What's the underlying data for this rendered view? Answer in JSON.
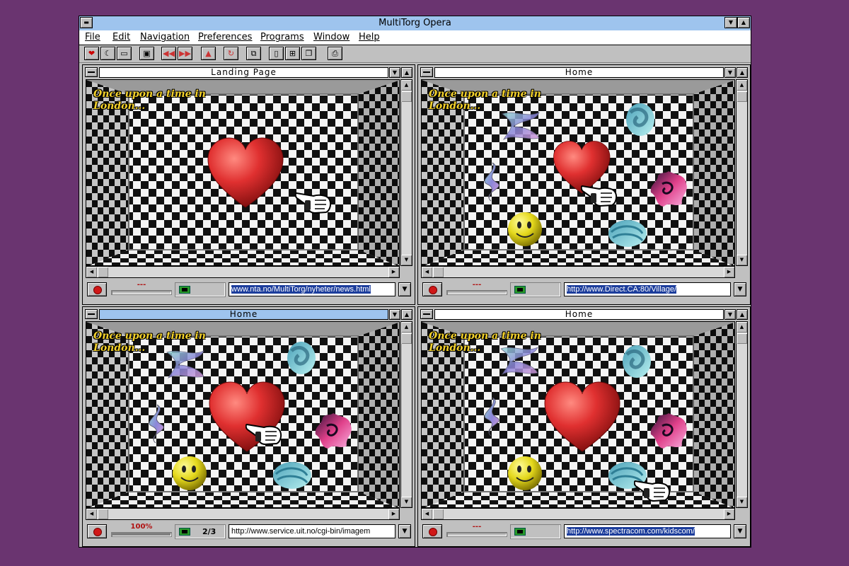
{
  "app": {
    "title": "MultiTorg Opera"
  },
  "menu": [
    "File",
    "Edit",
    "Navigation",
    "Preferences",
    "Programs",
    "Window",
    "Help"
  ],
  "toolbar_icons": [
    "opera-logo-icon",
    "back-moon-icon",
    "open-folder-icon",
    "save-icon",
    "previous-icon",
    "next-icon",
    "home-icon",
    "reload-icon",
    "copy-icon",
    "new-page-icon",
    "tile-icon",
    "cascade-icon",
    "print-icon"
  ],
  "panes": [
    {
      "title": "Landing Page",
      "story": "Once upon a time in London...",
      "progress_label": "---",
      "progress": 0,
      "counter": "",
      "url": "www.nta.no/MultiTorg/nyheter/news.html",
      "url_selected": true
    },
    {
      "title": "Home",
      "story": "Once upon a time in London...",
      "progress_label": "---",
      "progress": 0,
      "counter": "",
      "url": "http://www.Direct.CA:80/Village/",
      "url_selected": true
    },
    {
      "title": "Home",
      "story": "Once upon a time in London...",
      "progress_label": "100%",
      "progress": 1.0,
      "counter": "2/3",
      "url": "http://www.service.uit.no/cgi-bin/imagem",
      "url_selected": false
    },
    {
      "title": "Home",
      "story": "Once upon a time in London...",
      "progress_label": "---",
      "progress": 0,
      "counter": "",
      "url": "http://www.spectracom.com/kidscom/",
      "url_selected": true
    }
  ],
  "colors": {
    "background": "#6a3470",
    "active_title": "#9ec4ee",
    "story_text": "#f4d22c",
    "heart": "#e03030"
  }
}
